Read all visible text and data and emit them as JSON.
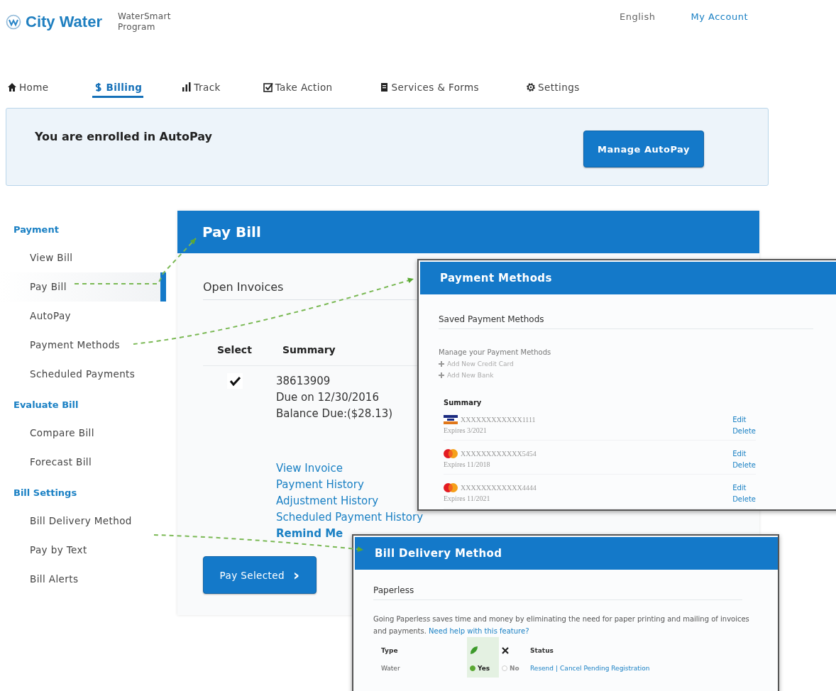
{
  "header": {
    "brand": "City Water",
    "program": "WaterSmart Program",
    "links": [
      {
        "label": "English",
        "kind": "plain"
      },
      {
        "label": "My Account",
        "kind": "link"
      }
    ]
  },
  "nav": [
    {
      "label": "Home",
      "selected": false
    },
    {
      "label": "Billing",
      "selected": true
    },
    {
      "label": "Track",
      "selected": false
    },
    {
      "label": "Take Action",
      "selected": false
    },
    {
      "label": "Services & Forms",
      "selected": false
    },
    {
      "label": "Settings",
      "selected": false
    }
  ],
  "banner": {
    "message": "You are enrolled in AutoPay",
    "button": "Manage AutoPay"
  },
  "sidebar": [
    {
      "heading": "Payment",
      "items": [
        {
          "label": "View Bill",
          "selected": false
        },
        {
          "label": "Pay Bill",
          "selected": true
        },
        {
          "label": "AutoPay",
          "selected": false
        },
        {
          "label": "Payment Methods",
          "selected": false
        },
        {
          "label": "Scheduled Payments",
          "selected": false
        }
      ]
    },
    {
      "heading": "Evaluate Bill",
      "items": [
        {
          "label": "Compare Bill",
          "selected": false
        },
        {
          "label": "Forecast Bill",
          "selected": false
        }
      ]
    },
    {
      "heading": "Bill Settings",
      "items": [
        {
          "label": "Bill Delivery Method",
          "selected": false
        },
        {
          "label": "Pay by Text",
          "selected": false
        },
        {
          "label": "Bill Alerts",
          "selected": false
        }
      ]
    }
  ],
  "pay_bill": {
    "title": "Pay Bill",
    "section": "Open Invoices",
    "columns": [
      "Select",
      "Summary"
    ],
    "invoice": {
      "checked": true,
      "lines": [
        "38613909",
        "Due on 12/30/2016",
        "Balance Due:($28.13)"
      ]
    },
    "links": [
      {
        "label": "View Invoice",
        "bold": false
      },
      {
        "label": "Payment History",
        "bold": false
      },
      {
        "label": "Adjustment History",
        "bold": false
      },
      {
        "label": "Scheduled Payment History",
        "bold": false
      },
      {
        "label": "Remind Me",
        "bold": true
      }
    ],
    "button": "Pay Selected",
    "button_icon": "›"
  },
  "payment_methods": {
    "title": "Payment Methods",
    "section": "Saved Payment Methods",
    "subtitle": "Manage your Payment Methods",
    "add_links": [
      "Add New Credit Card",
      "Add New Bank"
    ],
    "summary_heading": "Summary",
    "cards": [
      {
        "kind": "visa",
        "number": "XXXXXXXXXXXX1111",
        "expires": "Expires 3/2021",
        "actions": [
          "Edit",
          "Delete"
        ]
      },
      {
        "kind": "mastercard",
        "number": "XXXXXXXXXXXX5454",
        "expires": "Expires 11/2018",
        "actions": [
          "Edit",
          "Delete"
        ]
      },
      {
        "kind": "mastercard",
        "number": "XXXXXXXXXXXX4444",
        "expires": "Expires 11/2021",
        "actions": [
          "Edit",
          "Delete"
        ]
      }
    ]
  },
  "bill_delivery": {
    "title": "Bill Delivery Method",
    "section": "Paperless",
    "description": "Going Paperless saves time and money by eliminating the need for paper printing and mailing of invoices and payments.",
    "help_link": "Need help with this feature?",
    "columns": [
      "Type",
      "Status"
    ],
    "rows": [
      {
        "type": "Water",
        "options": [
          {
            "label": "Yes",
            "selected": true
          },
          {
            "label": "No",
            "selected": false
          }
        ],
        "status_links": [
          "Resend",
          "Cancel Pending Registration"
        ],
        "separator": "|"
      }
    ]
  }
}
